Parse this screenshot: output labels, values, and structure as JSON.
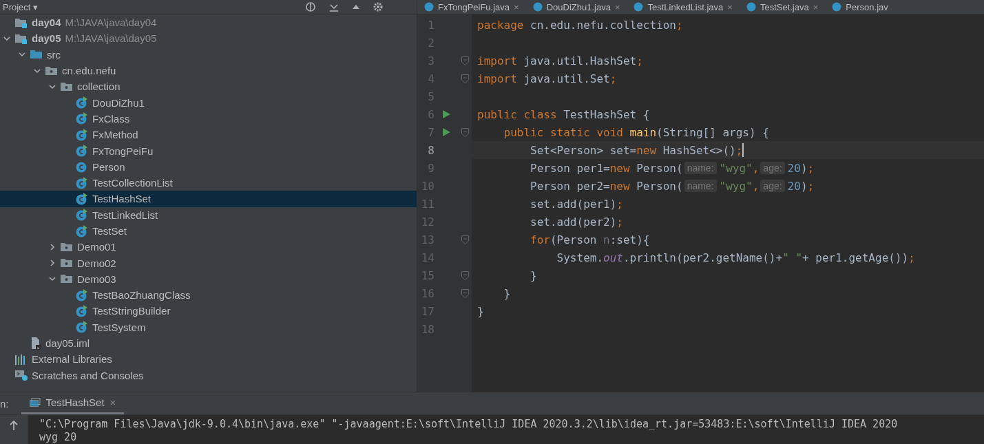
{
  "project_panel": {
    "title": "Project",
    "dropdown_arrow": "▾",
    "tree": [
      {
        "name": "day04",
        "path": "M:\\JAVA\\java\\day04",
        "kind": "module",
        "selected": false
      },
      {
        "name": "day05",
        "path": "M:\\JAVA\\java\\day05",
        "kind": "module",
        "expanded": true,
        "selected": false,
        "children": [
          {
            "name": "src",
            "kind": "source-folder",
            "expanded": true,
            "selected": false,
            "children": [
              {
                "name": "cn.edu.nefu",
                "kind": "package",
                "expanded": true,
                "selected": false,
                "children": [
                  {
                    "name": "collection",
                    "kind": "package",
                    "expanded": true,
                    "selected": false,
                    "children": [
                      {
                        "name": "DouDiZhu1",
                        "kind": "runnable-class",
                        "selected": false
                      },
                      {
                        "name": "FxClass",
                        "kind": "runnable-class",
                        "selected": false
                      },
                      {
                        "name": "FxMethod",
                        "kind": "runnable-class",
                        "selected": false
                      },
                      {
                        "name": "FxTongPeiFu",
                        "kind": "runnable-class",
                        "selected": false
                      },
                      {
                        "name": "Person",
                        "kind": "class",
                        "selected": false
                      },
                      {
                        "name": "TestCollectionList",
                        "kind": "runnable-class",
                        "selected": false
                      },
                      {
                        "name": "TestHashSet",
                        "kind": "runnable-class",
                        "selected": true
                      },
                      {
                        "name": "TestLinkedList",
                        "kind": "runnable-class",
                        "selected": false
                      },
                      {
                        "name": "TestSet",
                        "kind": "runnable-class",
                        "selected": false
                      }
                    ]
                  },
                  {
                    "name": "Demo01",
                    "kind": "package",
                    "expanded": false,
                    "selected": false
                  },
                  {
                    "name": "Demo02",
                    "kind": "package",
                    "expanded": false,
                    "selected": false
                  },
                  {
                    "name": "Demo03",
                    "kind": "package",
                    "expanded": true,
                    "selected": false,
                    "children": [
                      {
                        "name": "TestBaoZhuangClass",
                        "kind": "runnable-class",
                        "selected": false
                      },
                      {
                        "name": "TestStringBuilder",
                        "kind": "runnable-class",
                        "selected": false
                      },
                      {
                        "name": "TestSystem",
                        "kind": "runnable-class",
                        "selected": false
                      }
                    ]
                  }
                ]
              }
            ]
          },
          {
            "name": "day05.iml",
            "kind": "module-file",
            "selected": false
          }
        ]
      },
      {
        "name": "External Libraries",
        "kind": "libraries",
        "selected": false
      },
      {
        "name": "Scratches and Consoles",
        "kind": "scratches",
        "selected": false
      }
    ]
  },
  "editor_tabs": [
    {
      "label": "FxTongPeiFu.java",
      "close": "×",
      "selected": false
    },
    {
      "label": "DouDiZhu1.java",
      "close": "×",
      "selected": false
    },
    {
      "label": "TestLinkedList.java",
      "close": "×",
      "selected": false
    },
    {
      "label": "TestSet.java",
      "close": "×",
      "selected": false
    },
    {
      "label": "Person.jav",
      "selected": false
    }
  ],
  "code_lines": [
    {
      "number": "1",
      "run": false,
      "fold": false,
      "current": false,
      "tokens": [
        {
          "kind": "keyword",
          "text": "package"
        },
        {
          "kind": "plain",
          "text": " cn.edu.nefu.collection"
        },
        {
          "kind": "keyword",
          "text": ";"
        }
      ]
    },
    {
      "number": "2",
      "run": false,
      "fold": false,
      "current": false
    },
    {
      "number": "3",
      "run": false,
      "fold": true,
      "current": false,
      "tokens": [
        {
          "kind": "keyword",
          "text": "import"
        },
        {
          "kind": "plain",
          "text": " java.util.HashSet"
        },
        {
          "kind": "keyword",
          "text": ";"
        }
      ]
    },
    {
      "number": "4",
      "run": false,
      "fold": true,
      "current": false,
      "tokens": [
        {
          "kind": "keyword",
          "text": "import"
        },
        {
          "kind": "plain",
          "text": " java.util.Set"
        },
        {
          "kind": "keyword",
          "text": ";"
        }
      ]
    },
    {
      "number": "5",
      "run": false,
      "fold": false,
      "current": false
    },
    {
      "number": "6",
      "run": true,
      "fold": false,
      "current": false,
      "tokens": [
        {
          "kind": "keyword",
          "text": "public class"
        },
        {
          "kind": "plain",
          "text": " TestHashSet {"
        }
      ]
    },
    {
      "number": "7",
      "run": true,
      "fold": true,
      "current": false,
      "tokens": [
        {
          "kind": "keyword",
          "text": "    public static void"
        },
        {
          "kind": "method",
          "text": "main"
        },
        {
          "kind": "plain",
          "text": "(String[] args) {"
        }
      ]
    },
    {
      "number": "8",
      "run": false,
      "fold": false,
      "current": true,
      "tokens": [
        {
          "kind": "plain",
          "text": "        Set<Person> set="
        },
        {
          "kind": "keyword",
          "text": "new"
        },
        {
          "kind": "plain",
          "text": " HashSet<>()"
        },
        {
          "kind": "keyword",
          "text": ";"
        }
      ]
    },
    {
      "number": "9",
      "run": false,
      "fold": false,
      "current": false,
      "tokens": [
        {
          "kind": "plain",
          "text": "        Person per1="
        },
        {
          "kind": "keyword",
          "text": "new"
        },
        {
          "kind": "plain",
          "text": " Person("
        },
        {
          "kind": "hint",
          "text": "name:"
        },
        {
          "kind": "string",
          "text": "\"wyg\""
        },
        {
          "kind": "keyword",
          "text": ","
        },
        {
          "kind": "hint",
          "text": "age:"
        },
        {
          "kind": "number",
          "text": "20"
        },
        {
          "kind": "plain",
          "text": ")"
        },
        {
          "kind": "keyword",
          "text": ";"
        }
      ]
    },
    {
      "number": "10",
      "run": false,
      "fold": false,
      "current": false,
      "tokens": [
        {
          "kind": "plain",
          "text": "        Person per2="
        },
        {
          "kind": "keyword",
          "text": "new"
        },
        {
          "kind": "plain",
          "text": " Person("
        },
        {
          "kind": "hint",
          "text": "name:"
        },
        {
          "kind": "string",
          "text": "\"wyg\""
        },
        {
          "kind": "keyword",
          "text": ","
        },
        {
          "kind": "hint",
          "text": "age:"
        },
        {
          "kind": "number",
          "text": "20"
        },
        {
          "kind": "plain",
          "text": ")"
        },
        {
          "kind": "keyword",
          "text": ";"
        }
      ]
    },
    {
      "number": "11",
      "run": false,
      "fold": false,
      "current": false,
      "tokens": [
        {
          "kind": "plain",
          "text": "        set.add(per1)"
        },
        {
          "kind": "keyword",
          "text": ";"
        }
      ]
    },
    {
      "number": "12",
      "run": false,
      "fold": false,
      "current": false,
      "tokens": [
        {
          "kind": "plain",
          "text": "        set.add(per2)"
        },
        {
          "kind": "keyword",
          "text": ";"
        }
      ]
    },
    {
      "number": "13",
      "run": false,
      "fold": true,
      "current": false,
      "tokens": [
        {
          "kind": "keyword",
          "text": "        for"
        },
        {
          "kind": "plain",
          "text": "(Person "
        },
        {
          "kind": "unused",
          "text": "n"
        },
        {
          "kind": "plain",
          "text": ":set){"
        }
      ]
    },
    {
      "number": "14",
      "run": false,
      "fold": false,
      "current": false,
      "tokens": [
        {
          "kind": "plain",
          "text": "            System."
        },
        {
          "kind": "static-field",
          "text": "out"
        },
        {
          "kind": "plain",
          "text": ".println(per2.getName()+"
        },
        {
          "kind": "string",
          "text": "\" \""
        },
        {
          "kind": "plain",
          "text": "+ per1.getAge())"
        },
        {
          "kind": "keyword",
          "text": ";"
        }
      ]
    },
    {
      "number": "15",
      "run": false,
      "fold": true,
      "current": false,
      "tokens": [
        {
          "kind": "plain",
          "text": "        }"
        }
      ]
    },
    {
      "number": "16",
      "run": false,
      "fold": true,
      "current": false,
      "tokens": [
        {
          "kind": "plain",
          "text": "    }"
        }
      ]
    },
    {
      "number": "17",
      "run": false,
      "fold": false,
      "current": false,
      "tokens": [
        {
          "kind": "plain",
          "text": "}"
        }
      ]
    },
    {
      "number": "18",
      "run": false,
      "fold": false,
      "current": false
    }
  ],
  "run_panel": {
    "label": "n:",
    "tabs": [
      {
        "label": "TestHashSet",
        "close": "×",
        "selected": true
      }
    ],
    "console_lines": [
      "\"C:\\Program Files\\Java\\jdk-9.0.4\\bin\\java.exe\" \"-javaagent:E:\\soft\\IntelliJ IDEA 2020.3.2\\lib\\idea_rt.jar=53483:E:\\soft\\IntelliJ IDEA 2020",
      "wyg 20"
    ]
  }
}
